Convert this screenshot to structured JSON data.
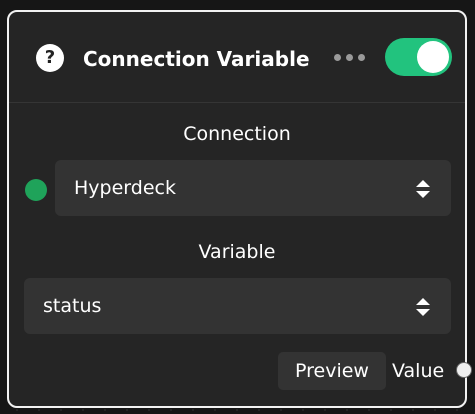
{
  "node": {
    "title": "Connection Variable",
    "help_icon_glyph": "?",
    "enabled": true,
    "colors": {
      "toggle_on": "#22c37e",
      "status_connected": "#1fa35a",
      "node_background": "#252525",
      "input_background": "#333333"
    }
  },
  "connection": {
    "label": "Connection",
    "selected": "Hyperdeck",
    "status": "connected"
  },
  "variable": {
    "label": "Variable",
    "selected": "status"
  },
  "footer": {
    "preview_label": "Preview",
    "output_label": "Value"
  },
  "icons": {
    "help": "help-icon",
    "more": "more-horizontal-icon",
    "select": "chevron-up-down-icon"
  }
}
